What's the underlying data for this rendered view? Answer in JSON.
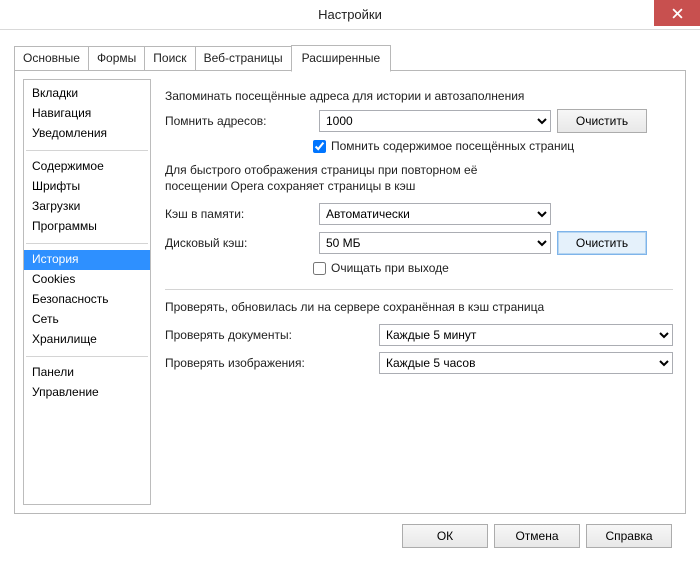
{
  "window": {
    "title": "Настройки"
  },
  "tabs": [
    "Основные",
    "Формы",
    "Поиск",
    "Веб-страницы",
    "Расширенные"
  ],
  "active_tab": 4,
  "sidebar": {
    "groups": [
      [
        "Вкладки",
        "Навигация",
        "Уведомления"
      ],
      [
        "Содержимое",
        "Шрифты",
        "Загрузки",
        "Программы"
      ],
      [
        "История",
        "Cookies",
        "Безопасность",
        "Сеть",
        "Хранилище"
      ],
      [
        "Панели",
        "Управление"
      ]
    ],
    "selected": "История"
  },
  "main": {
    "remember_intro": "Запоминать посещённые адреса для истории и автозаполнения",
    "remember_label": "Помнить адресов:",
    "remember_value": "1000",
    "clear1": "Очистить",
    "remember_content_chk": "Помнить содержимое посещённых страниц",
    "cache_intro1": "Для быстрого отображения страницы при повторном её",
    "cache_intro2": "посещении Opera сохраняет страницы в кэш",
    "mem_cache_label": "Кэш в памяти:",
    "mem_cache_value": "Автоматически",
    "disk_cache_label": "Дисковый кэш:",
    "disk_cache_value": "50 МБ",
    "clear2": "Очистить",
    "clear_on_exit": "Очищать при выходе",
    "check_intro": "Проверять, обновилась ли на сервере сохранённая в кэш страница",
    "check_docs_label": "Проверять документы:",
    "check_docs_value": "Каждые 5 минут",
    "check_imgs_label": "Проверять изображения:",
    "check_imgs_value": "Каждые 5 часов"
  },
  "footer": {
    "ok": "ОК",
    "cancel": "Отмена",
    "help": "Справка"
  }
}
